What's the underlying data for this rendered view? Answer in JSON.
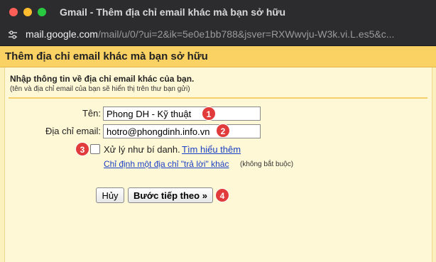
{
  "window": {
    "title": "Gmail - Thêm địa chỉ email khác mà bạn sở hữu",
    "controls": [
      "close",
      "minimize",
      "maximize"
    ]
  },
  "url_bar": {
    "icon": "tune-icon",
    "host": "mail.google.com",
    "path": "/mail/u/0/?ui=2&ik=5e0e1bb788&jsver=RXWwvju-W3k.vi.L.es5&c..."
  },
  "dialog": {
    "title": "Thêm địa chỉ email khác mà bạn sở hữu",
    "instruction": "Nhập thông tin về địa chỉ email khác của bạn.",
    "instruction_note": "(tên và địa chỉ email của bạn sẽ hiển thị trên thư bạn gửi)",
    "name_label": "Tên:",
    "name_value": "Phong DH - Kỹ thuật",
    "email_label": "Địa chỉ email:",
    "email_value": "hotro@phongdinh.info.vn",
    "alias_label": "Xử lý như bí danh.",
    "alias_checked": false,
    "learn_more": "Tìm hiểu thêm",
    "reply_to_link": "Chỉ định một địa chỉ \"trả lời\" khác",
    "optional_note": "(không bắt buộc)",
    "cancel_button": "Hủy",
    "next_button": "Bước tiếp theo »"
  },
  "annotations": {
    "badge_1": "1",
    "badge_2": "2",
    "badge_3": "3",
    "badge_4": "4",
    "badge_color": "#e23b3b"
  }
}
